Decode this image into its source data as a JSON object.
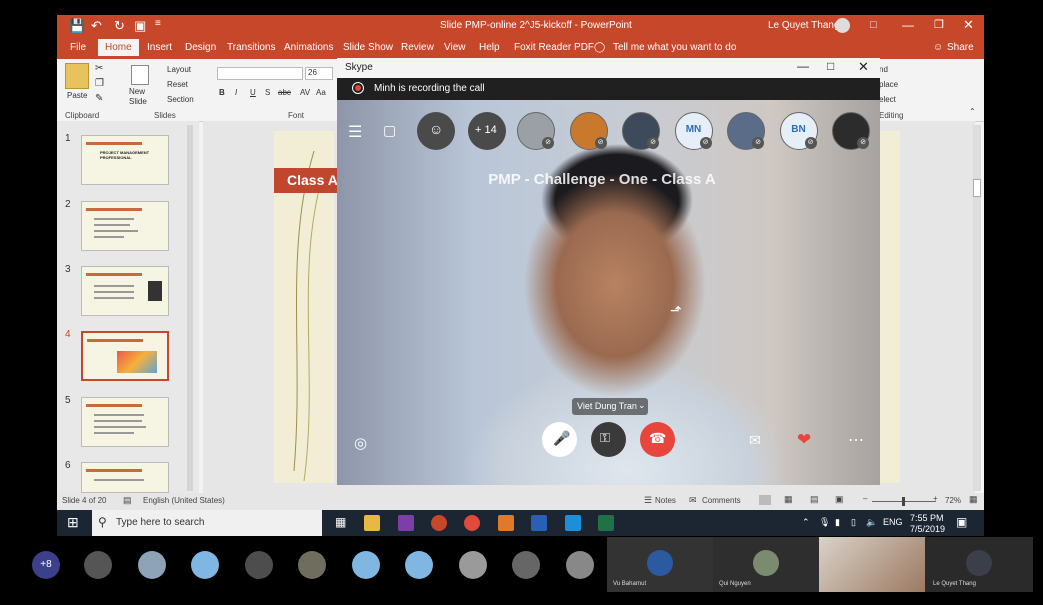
{
  "ppt": {
    "title": "Slide PMP-online 2^J5-kickoff  -  PowerPoint",
    "user": "Le Quyet Thang",
    "tabs": [
      "File",
      "Home",
      "Insert",
      "Design",
      "Transitions",
      "Animations",
      "Slide Show",
      "Review",
      "View",
      "Help",
      "Foxit Reader PDF"
    ],
    "tell_me": "Tell me what you want to do",
    "share": "Share",
    "ribbon": {
      "paste": "Paste",
      "new_slide": "New Slide",
      "layout": "Layout",
      "reset": "Reset",
      "section": "Section",
      "font_size": "26",
      "groups": {
        "clipboard": "Clipboard",
        "slides": "Slides",
        "font": "Font",
        "editing": "Editing"
      },
      "right_labels": [
        "nd",
        "place",
        "elect"
      ]
    },
    "slides": [
      "1",
      "2",
      "3",
      "4",
      "5",
      "6"
    ],
    "thumb1_text": "PROJECT MANAGEMENT PROFESSIONAL",
    "current_slide_label": "Class A",
    "status": {
      "slide_info": "Slide 4 of 20",
      "language": "English (United States)",
      "notes": "Notes",
      "comments": "Comments",
      "zoom": "72%"
    }
  },
  "skype": {
    "window_title": "Skype",
    "recording_text": "Minh is recording the call",
    "add_count": "+ 14",
    "participants": [
      {
        "initials": "",
        "color": "#9aa0a6"
      },
      {
        "initials": "",
        "color": "#c8792e"
      },
      {
        "initials": "",
        "color": "#3d4a5c"
      },
      {
        "initials": "MN",
        "color": "#e6eef7"
      },
      {
        "initials": "",
        "color": "#5a6c88"
      },
      {
        "initials": "BN",
        "color": "#e6eef7"
      },
      {
        "initials": "",
        "color": "#2c2c2c"
      }
    ],
    "call_title": "PMP - Challenge - One - Class A",
    "speaker_name": "Viet Dung Tran"
  },
  "taskbar": {
    "search_placeholder": "Type here to search",
    "lang": "ENG",
    "time": "7:55 PM",
    "date": "7/5/2019",
    "apps": [
      {
        "name": "file-explorer",
        "color": "#e8b845"
      },
      {
        "name": "onenote",
        "color": "#7b3fa8"
      },
      {
        "name": "powerpoint",
        "color": "#c7472b"
      },
      {
        "name": "chrome",
        "color": "#e04a3a"
      },
      {
        "name": "app",
        "color": "#e07a2b"
      },
      {
        "name": "word",
        "color": "#2b5fb3"
      },
      {
        "name": "skype",
        "color": "#1c8fd8"
      },
      {
        "name": "excel",
        "color": "#1f7244"
      }
    ]
  },
  "bottom_strip": {
    "overflow": "+8",
    "names": [
      "Vu Baharnut",
      "Qui Nguyen",
      "Le Quyet Thang"
    ]
  }
}
